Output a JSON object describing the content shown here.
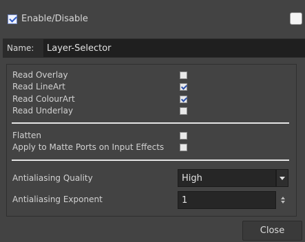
{
  "header": {
    "enable_label": "Enable/Disable",
    "enable_checked": true,
    "right_toggle_checked": false
  },
  "name_field": {
    "label": "Name:",
    "value": "Layer-Selector"
  },
  "read_options": [
    {
      "label": "Read Overlay",
      "checked": false
    },
    {
      "label": "Read LineArt",
      "checked": true
    },
    {
      "label": "Read ColourArt",
      "checked": true
    },
    {
      "label": "Read Underlay",
      "checked": false
    }
  ],
  "effect_options": [
    {
      "label": "Flatten",
      "checked": false
    },
    {
      "label": "Apply to Matte Ports on Input Effects",
      "checked": false
    }
  ],
  "antialiasing": {
    "quality_label": "Antialiasing Quality",
    "quality_value": "High",
    "exponent_label": "Antialiasing Exponent",
    "exponent_value": "1"
  },
  "footer": {
    "close_label": "Close"
  },
  "icons": {
    "dropdown": "chevron-down-icon",
    "spinner": "spinner-arrows-icon"
  }
}
